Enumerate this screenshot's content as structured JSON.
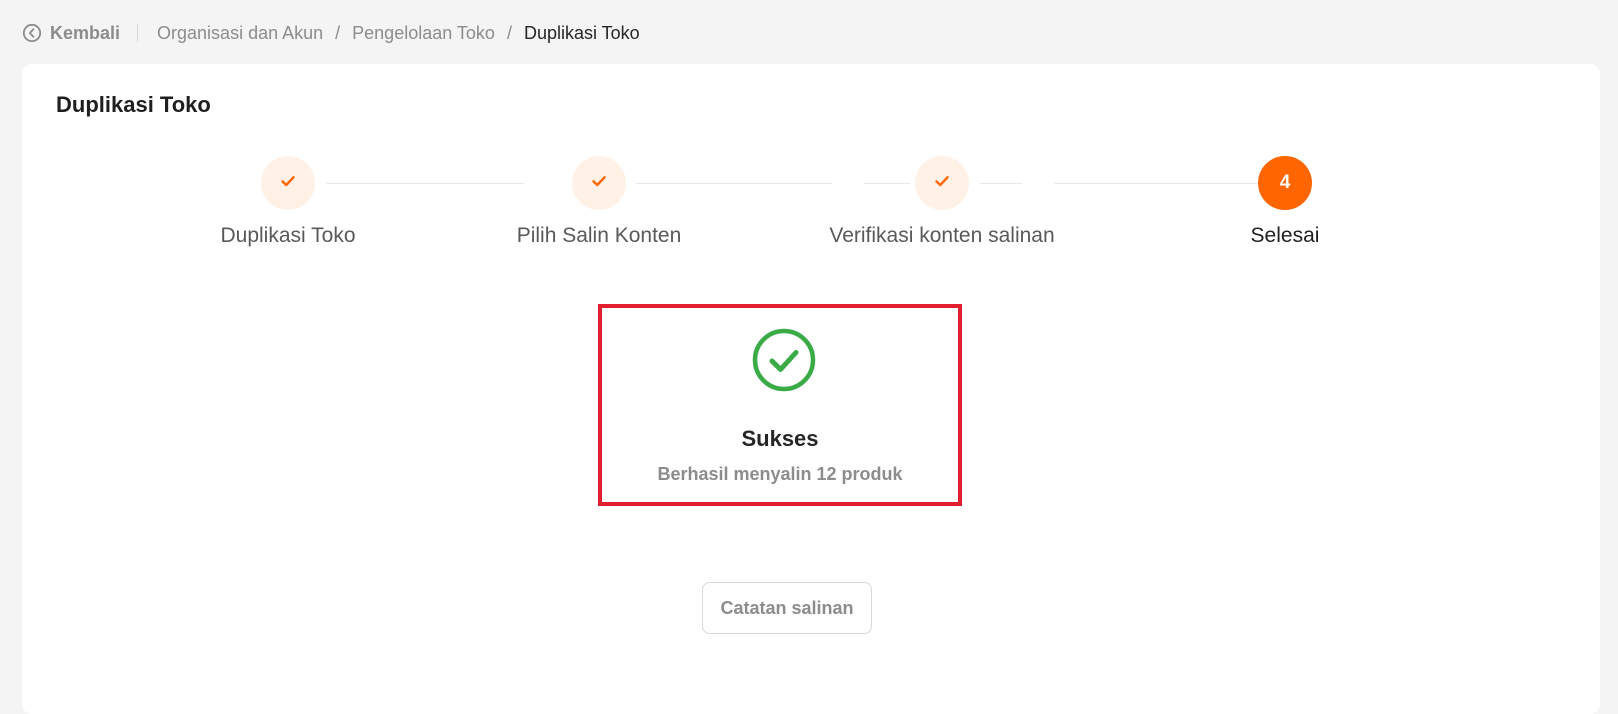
{
  "header": {
    "back_label": "Kembali",
    "breadcrumb": [
      "Organisasi dan Akun",
      "Pengelolaan Toko",
      "Duplikasi Toko"
    ],
    "separator": "/"
  },
  "page": {
    "title": "Duplikasi Toko"
  },
  "steps": [
    {
      "label": "Duplikasi Toko",
      "status": "done",
      "icon": "check-icon"
    },
    {
      "label": "Pilih Salin Konten",
      "status": "done",
      "icon": "check-icon"
    },
    {
      "label": "Verifikasi konten salinan",
      "status": "done",
      "icon": "check-icon"
    },
    {
      "label": "Selesai",
      "status": "active",
      "number": "4"
    }
  ],
  "result": {
    "icon": "success-check-circle-icon",
    "title": "Sukses",
    "subtitle": "Berhasil menyalin 12 produk"
  },
  "actions": {
    "log_button": "Catatan salinan"
  },
  "colors": {
    "accent": "#ff6500",
    "accent_light": "#fff1e6",
    "success": "#3aab47",
    "highlight_border": "#e0202e"
  }
}
